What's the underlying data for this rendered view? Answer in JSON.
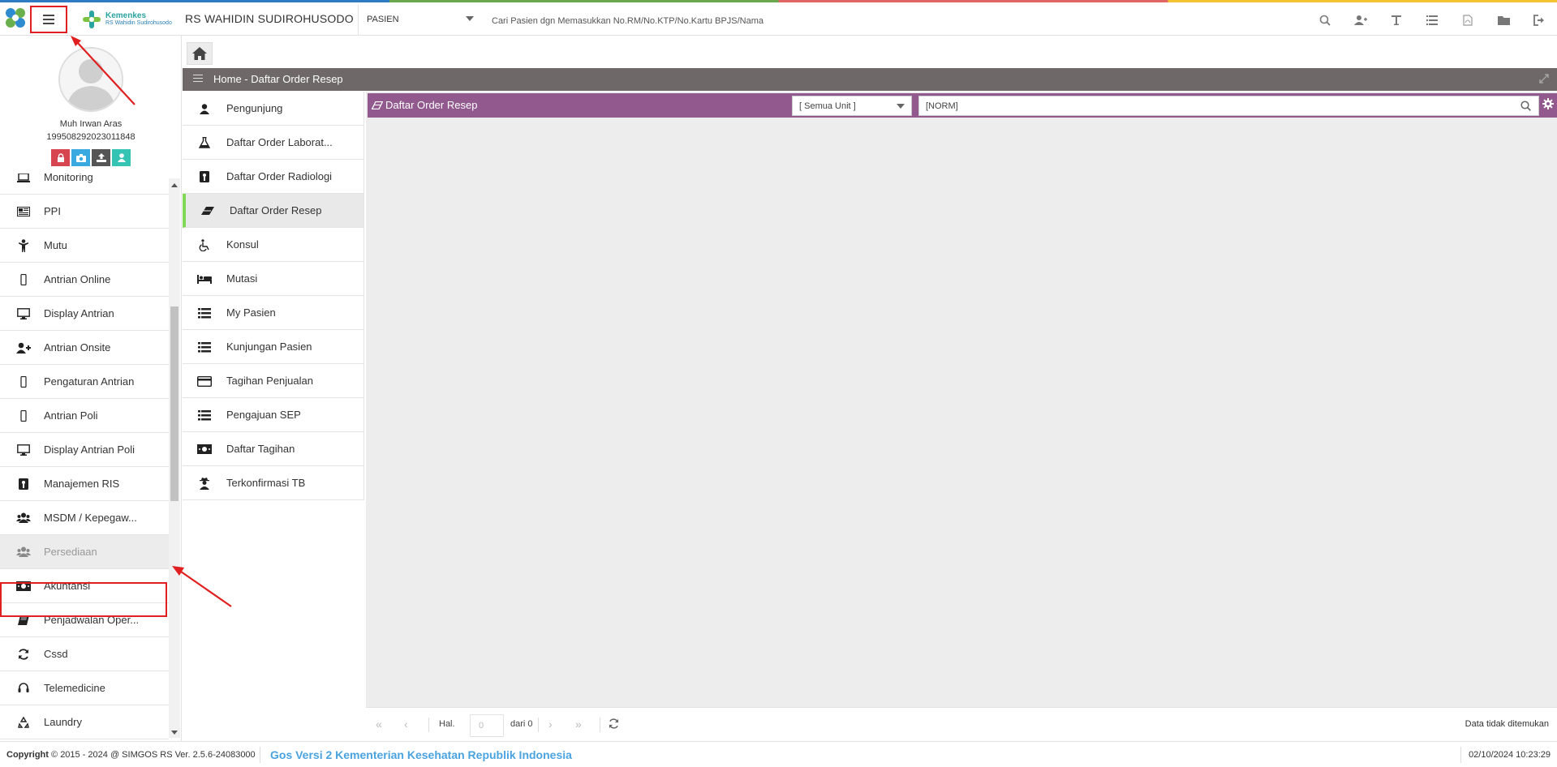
{
  "header": {
    "brand_logo_line1": "Kemenkes",
    "brand_logo_line2": "RS Wahidin Sudirohusodo",
    "hospital_name": "RS WAHIDIN SUDIROHUSODO",
    "module_select": "PASIEN",
    "search_placeholder": "Cari Pasien dgn Memasukkan No.RM/No.KTP/No.Kartu BPJS/Nama",
    "icons": [
      "search-icon",
      "add-user-icon",
      "text-icon",
      "list-icon",
      "pdf-file-icon",
      "folder-icon",
      "logout-icon"
    ]
  },
  "profile": {
    "name": "Muh Irwan Aras",
    "id": "199508292023011848",
    "actions": [
      "lock-icon",
      "camera-icon",
      "upload-icon",
      "user-icon"
    ]
  },
  "sidebar": {
    "items": [
      {
        "label": "Monitoring",
        "icon": "laptop-icon"
      },
      {
        "label": "PPI",
        "icon": "newspaper-icon"
      },
      {
        "label": "Mutu",
        "icon": "child-icon"
      },
      {
        "label": "Antrian Online",
        "icon": "mobile-icon"
      },
      {
        "label": "Display Antrian",
        "icon": "desktop-icon"
      },
      {
        "label": "Antrian Onsite",
        "icon": "user-plus-icon"
      },
      {
        "label": "Pengaturan Antrian",
        "icon": "mobile-icon"
      },
      {
        "label": "Antrian Poli",
        "icon": "mobile-icon"
      },
      {
        "label": "Display Antrian Poli",
        "icon": "desktop-icon"
      },
      {
        "label": "Manajemen RIS",
        "icon": "xray-icon"
      },
      {
        "label": "MSDM / Kepegaw...",
        "icon": "users-icon"
      },
      {
        "label": "Persediaan",
        "icon": "users-icon"
      },
      {
        "label": "Akuntansi",
        "icon": "money-icon"
      },
      {
        "label": "Penjadwalan Oper...",
        "icon": "book-icon"
      },
      {
        "label": "Cssd",
        "icon": "refresh-icon"
      },
      {
        "label": "Telemedicine",
        "icon": "headset-icon"
      },
      {
        "label": "Laundry",
        "icon": "recycle-icon"
      }
    ]
  },
  "main": {
    "breadcrumb": "Home - Daftar Order Resep",
    "subnav": [
      {
        "label": "Pengunjung",
        "icon": "user-icon"
      },
      {
        "label": "Daftar Order Laborat...",
        "icon": "flask-icon"
      },
      {
        "label": "Daftar Order Radiologi",
        "icon": "xray-icon"
      },
      {
        "label": "Daftar Order Resep",
        "icon": "eraser-icon"
      },
      {
        "label": "Konsul",
        "icon": "wheelchair-icon"
      },
      {
        "label": "Mutasi",
        "icon": "bed-icon"
      },
      {
        "label": "My Pasien",
        "icon": "list-icon"
      },
      {
        "label": "Kunjungan Pasien",
        "icon": "list-icon"
      },
      {
        "label": "Tagihan Penjualan",
        "icon": "credit-card-icon"
      },
      {
        "label": "Pengajuan SEP",
        "icon": "list-icon"
      },
      {
        "label": "Daftar Tagihan",
        "icon": "money-icon"
      },
      {
        "label": "Terkonfirmasi TB",
        "icon": "user-secret-icon"
      }
    ],
    "panel": {
      "title": "Daftar Order Resep",
      "unit_select": "[ Semua Unit ]",
      "norm_value": "[NORM]"
    },
    "pager": {
      "hal_label": "Hal.",
      "page_value": "0",
      "of_label": "dari 0",
      "status": "Data tidak ditemukan"
    }
  },
  "footer": {
    "copyright_prefix": "Copyright",
    "copyright_text": "2015 - 2024 @ SIMGOS RS Ver. 2.5.6-24083000",
    "marquee": "Gos Versi 2 Kementerian Kesehatan Republik Indonesia",
    "clock": "02/10/2024 10:23:29"
  },
  "colors": {
    "panel_header": "#92598e",
    "title_bar": "#6e6868",
    "active_accent": "#7ed957",
    "annotation": "#e02020"
  }
}
